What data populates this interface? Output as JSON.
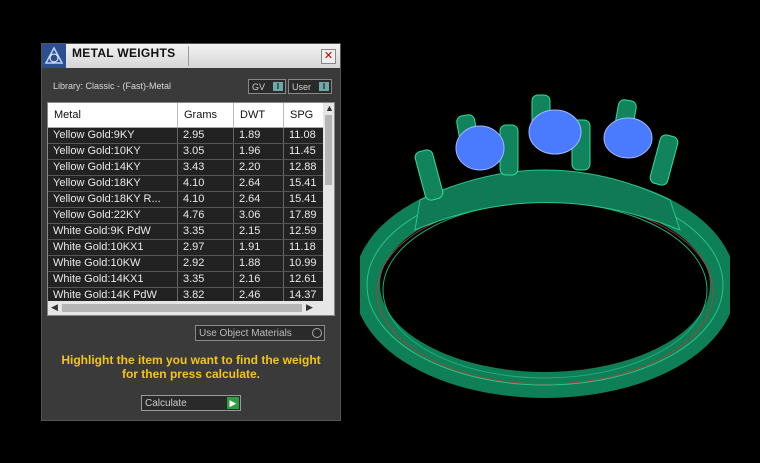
{
  "window": {
    "title": "METAL WEIGHTS",
    "close_icon": "close-icon",
    "logo_icon": "metal-weights-logo-icon"
  },
  "library": {
    "label": "Library: Classic - (Fast)-Metal"
  },
  "toggles": {
    "gv_label": "GV",
    "gv_knob": "I",
    "user_label": "User",
    "user_knob": "I"
  },
  "table": {
    "columns": [
      "Metal",
      "Grams",
      "DWT",
      "SPG"
    ],
    "rows": [
      [
        "Yellow Gold:9KY",
        "2.95",
        "1.89",
        "11.08"
      ],
      [
        "Yellow Gold:10KY",
        "3.05",
        "1.96",
        "11.45"
      ],
      [
        "Yellow Gold:14KY",
        "3.43",
        "2.20",
        "12.88"
      ],
      [
        "Yellow Gold:18KY",
        "4.10",
        "2.64",
        "15.41"
      ],
      [
        "Yellow Gold:18KY R...",
        "4.10",
        "2.64",
        "15.41"
      ],
      [
        "Yellow Gold:22KY",
        "4.76",
        "3.06",
        "17.89"
      ],
      [
        "White Gold:9K PdW",
        "3.35",
        "2.15",
        "12.59"
      ],
      [
        "White Gold:10KX1",
        "2.97",
        "1.91",
        "11.18"
      ],
      [
        "White Gold:10KW",
        "2.92",
        "1.88",
        "10.99"
      ],
      [
        "White Gold:14KX1",
        "3.35",
        "2.16",
        "12.61"
      ],
      [
        "White Gold:14K PdW",
        "3.82",
        "2.46",
        "14.37"
      ]
    ]
  },
  "use_object_materials": {
    "label": "Use Object Materials"
  },
  "instruction": "Highlight the item you want to find the weight for then press calculate.",
  "calculate": {
    "label": "Calculate"
  },
  "colors": {
    "accent_text": "#f5c518",
    "ring_metal": "#0f7a55",
    "gem": "#4a7bff"
  }
}
